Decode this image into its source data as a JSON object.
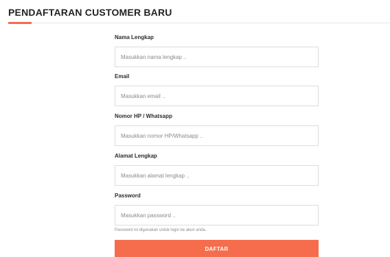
{
  "page": {
    "title": "PENDAFTARAN CUSTOMER BARU",
    "accent_color": "#f26b4a"
  },
  "form": {
    "fields": [
      {
        "label": "Nama Lengkap",
        "placeholder": "Masukkan nama lengkap ..",
        "value": ""
      },
      {
        "label": "Email",
        "placeholder": "Masukkan email ..",
        "value": ""
      },
      {
        "label": "Nomor HP / Whatsapp",
        "placeholder": "Masukkan nomor HP/Whatsapp ..",
        "value": ""
      },
      {
        "label": "Alamat Lengkap",
        "placeholder": "Masukkan alamat lengkap ..",
        "value": ""
      },
      {
        "label": "Password",
        "placeholder": "Masukkan password ..",
        "value": "",
        "help": "Password ini digunakan untuk login ke akun anda."
      }
    ],
    "submit_label": "DAFTAR",
    "submit_color": "#f56d4c"
  }
}
